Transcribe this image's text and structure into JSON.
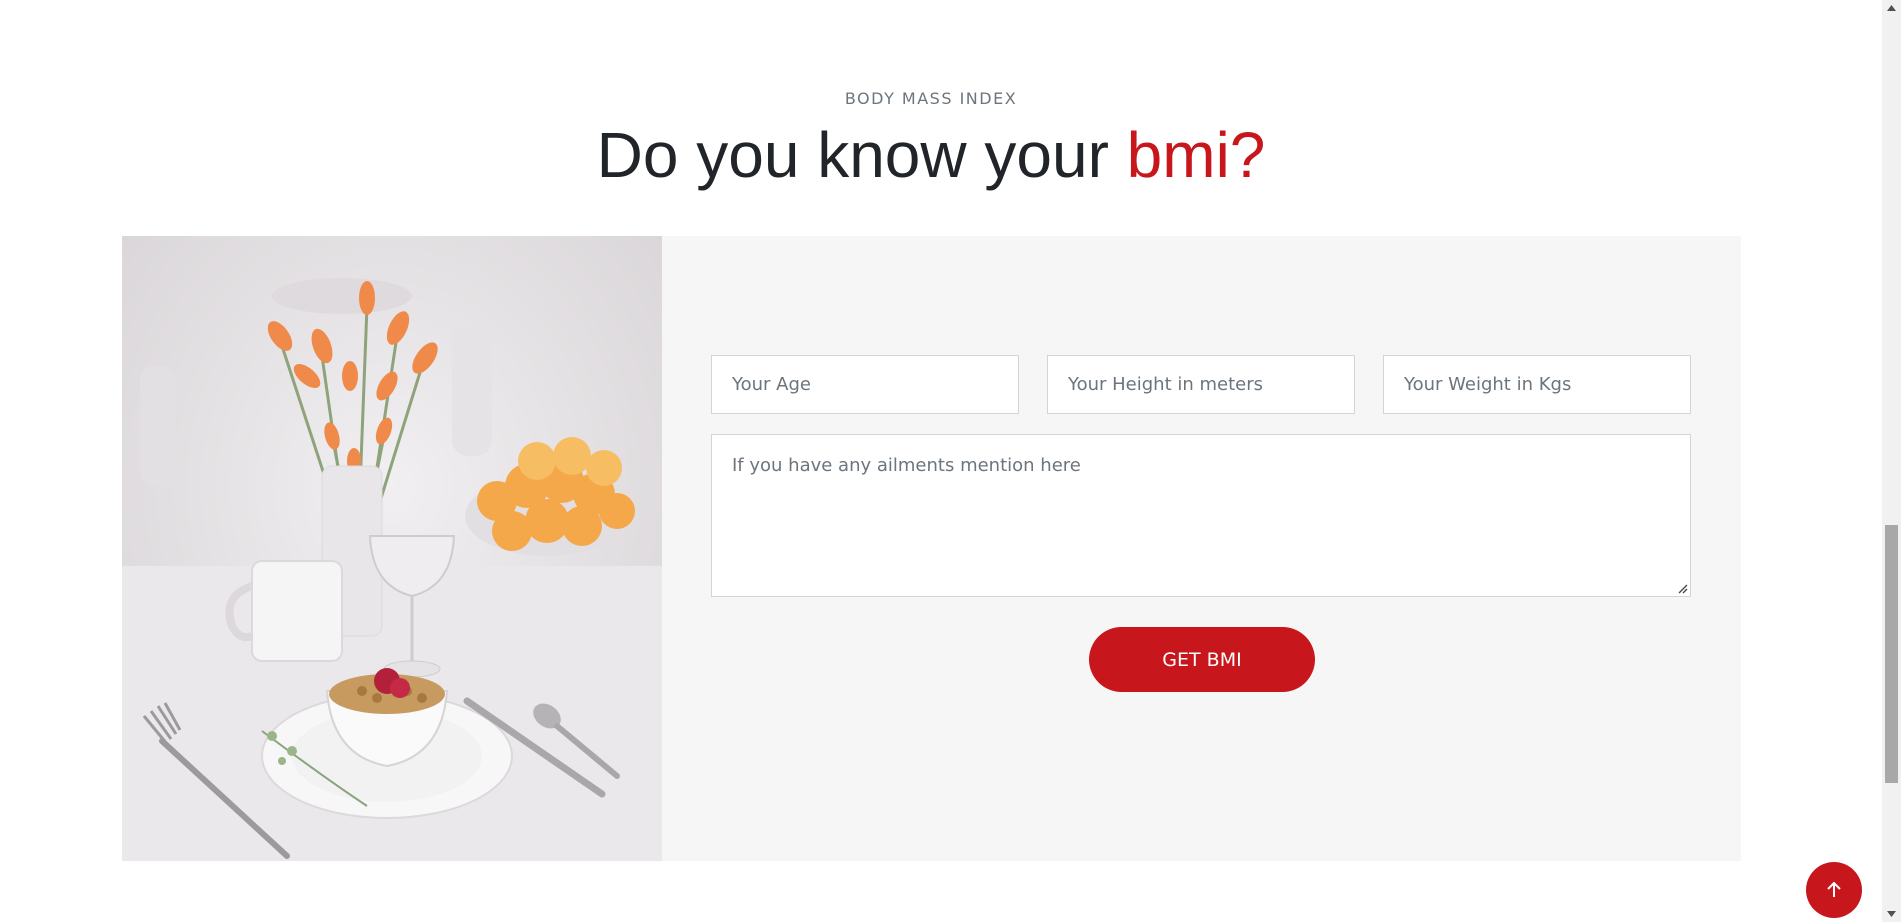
{
  "header": {
    "eyebrow": "BODY MASS INDEX",
    "title_main": "Do you know your",
    "title_accent": "bmi?"
  },
  "form": {
    "age_placeholder": "Your Age",
    "height_placeholder": "Your Height in meters",
    "weight_placeholder": "Your Weight in Kgs",
    "ailments_placeholder": "If you have any ailments mention here",
    "submit_label": "GET BMI"
  },
  "icons": {
    "back_to_top": "arrow-up-icon",
    "resize": "resize-handle-icon"
  },
  "colors": {
    "accent": "#c8161d",
    "panel": "#f6f6f6",
    "text": "#212529",
    "muted": "#6c757d"
  }
}
